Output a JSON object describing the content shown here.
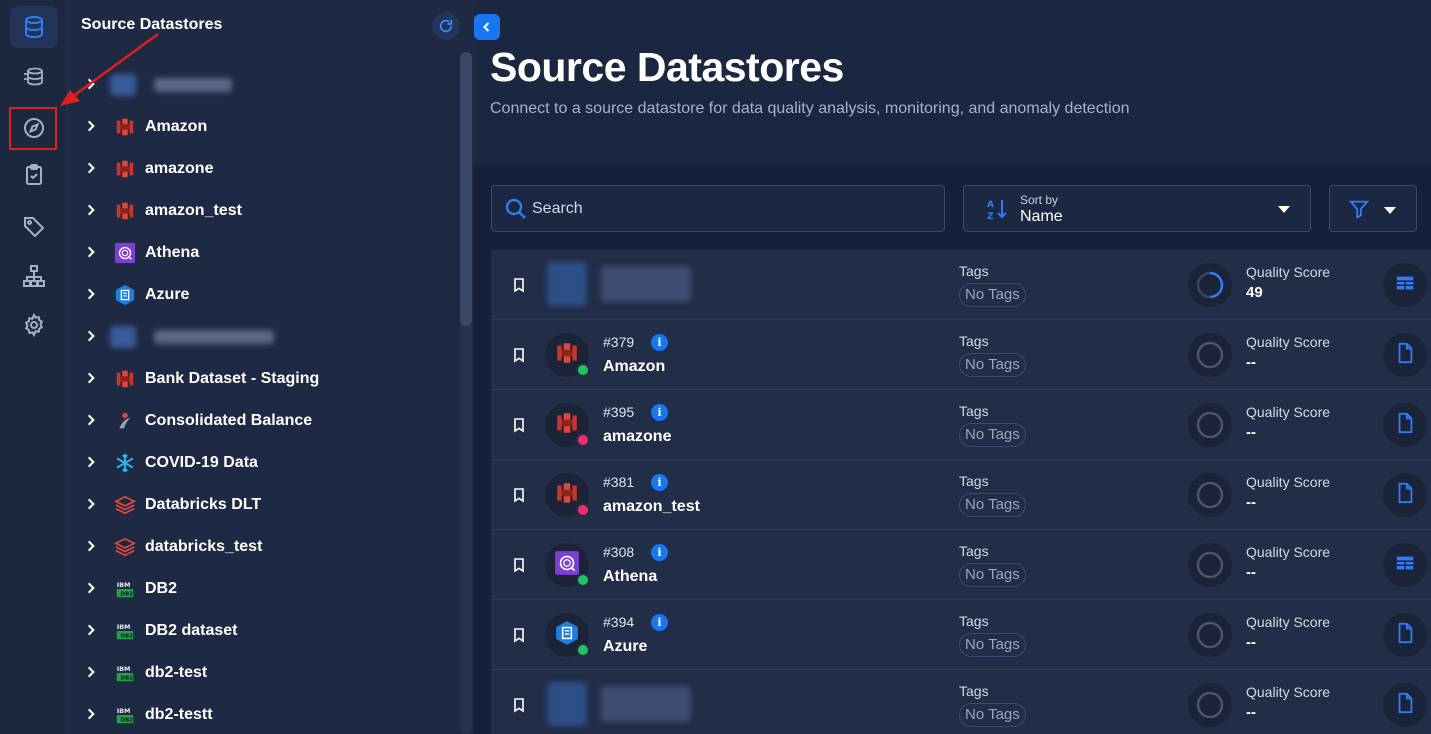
{
  "sidebar_title": "Source Datastores",
  "rail": {
    "items": [
      {
        "icon": "database-icon",
        "active": true
      },
      {
        "icon": "enrichment-datastore-icon",
        "active": false
      },
      {
        "icon": "compass-icon",
        "active": false,
        "highlighted": true
      },
      {
        "icon": "clipboard-check-icon",
        "active": false
      },
      {
        "icon": "tag-icon",
        "active": false
      },
      {
        "icon": "hierarchy-icon",
        "active": false
      },
      {
        "icon": "gear-icon",
        "active": false
      }
    ]
  },
  "tree": {
    "items": [
      {
        "label": "",
        "icon": "blurred",
        "blurred": true
      },
      {
        "label": "Amazon",
        "icon": "aws-icon"
      },
      {
        "label": "amazone",
        "icon": "aws-icon"
      },
      {
        "label": "amazon_test",
        "icon": "aws-icon"
      },
      {
        "label": "Athena",
        "icon": "athena-icon"
      },
      {
        "label": "Azure",
        "icon": "azure-icon"
      },
      {
        "label": "",
        "icon": "blurred",
        "blurred": true
      },
      {
        "label": "Bank Dataset - Staging",
        "icon": "aws-icon"
      },
      {
        "label": "Consolidated Balance",
        "icon": "dremio-icon"
      },
      {
        "label": "COVID-19 Data",
        "icon": "snowflake-icon"
      },
      {
        "label": "Databricks DLT",
        "icon": "databricks-icon"
      },
      {
        "label": "databricks_test",
        "icon": "databricks-icon"
      },
      {
        "label": "DB2",
        "icon": "ibm-db2-icon"
      },
      {
        "label": "DB2 dataset",
        "icon": "ibm-db2-icon"
      },
      {
        "label": "db2-test",
        "icon": "ibm-db2-icon"
      },
      {
        "label": "db2-testt",
        "icon": "ibm-db2-icon"
      }
    ]
  },
  "header": {
    "title": "Source Datastores",
    "subtitle": "Connect to a source datastore for data quality analysis, monitoring, and anomaly detection"
  },
  "search": {
    "placeholder": "Search"
  },
  "sort": {
    "caption": "Sort by",
    "value": "Name"
  },
  "list": {
    "rows": [
      {
        "id": "",
        "name": "",
        "blurred": true,
        "tags_label": "Tags",
        "tags": "No Tags",
        "qs_label": "Quality Score",
        "qs": "49",
        "type": "table-icon",
        "status_color": "#22c55e",
        "source_icon": "blurred"
      },
      {
        "id": "#379",
        "name": "Amazon",
        "blurred": false,
        "tags_label": "Tags",
        "tags": "No Tags",
        "qs_label": "Quality Score",
        "qs": "--",
        "type": "file-icon",
        "status_color": "#22c55e",
        "source_icon": "aws-icon"
      },
      {
        "id": "#395",
        "name": "amazone",
        "blurred": false,
        "tags_label": "Tags",
        "tags": "No Tags",
        "qs_label": "Quality Score",
        "qs": "--",
        "type": "file-icon",
        "status_color": "#ef2d6a",
        "source_icon": "aws-icon"
      },
      {
        "id": "#381",
        "name": "amazon_test",
        "blurred": false,
        "tags_label": "Tags",
        "tags": "No Tags",
        "qs_label": "Quality Score",
        "qs": "--",
        "type": "file-icon",
        "status_color": "#ef2d6a",
        "source_icon": "aws-icon"
      },
      {
        "id": "#308",
        "name": "Athena",
        "blurred": false,
        "tags_label": "Tags",
        "tags": "No Tags",
        "qs_label": "Quality Score",
        "qs": "--",
        "type": "table-icon",
        "status_color": "#22c55e",
        "source_icon": "athena-icon"
      },
      {
        "id": "#394",
        "name": "Azure",
        "blurred": false,
        "tags_label": "Tags",
        "tags": "No Tags",
        "qs_label": "Quality Score",
        "qs": "--",
        "type": "file-icon",
        "status_color": "#22c55e",
        "source_icon": "azure-icon"
      },
      {
        "id": "",
        "name": "",
        "blurred": true,
        "tags_label": "Tags",
        "tags": "No Tags",
        "qs_label": "Quality Score",
        "qs": "--",
        "type": "file-icon",
        "status_color": "#22c55e",
        "source_icon": "blurred"
      }
    ]
  },
  "colors": {
    "accent": "#1876f2",
    "background": "#1b2640",
    "panel": "#1e2943",
    "annotation": "#e11d1d"
  }
}
